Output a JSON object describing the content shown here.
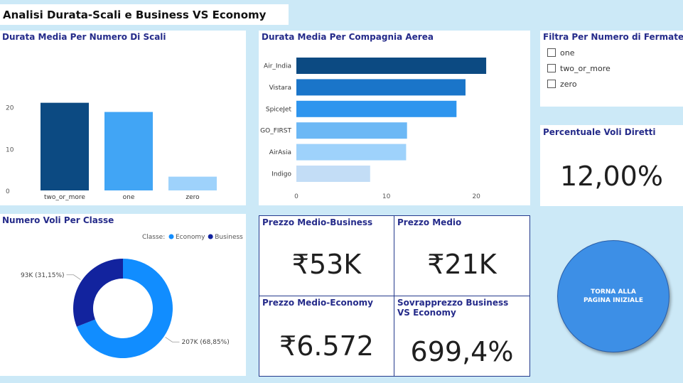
{
  "header": {
    "title": "Analisi Durata-Scali e Business VS Economy"
  },
  "stops_chart": {
    "title": "Durata Media Per Numero Di Scali",
    "chart_data": {
      "type": "bar",
      "categories": [
        "two_or_more",
        "one",
        "zero"
      ],
      "values": [
        21.0,
        18.8,
        3.3
      ],
      "colors": [
        "#0c4a82",
        "#41a5f5",
        "#9ed2fb"
      ],
      "yticks": [
        "0",
        "10",
        "20"
      ],
      "ylim": [
        0,
        22.3
      ]
    }
  },
  "airline_chart": {
    "title": "Durata Media Per Compagnia Aerea",
    "chart_data": {
      "type": "bar",
      "orientation": "horizontal",
      "categories": [
        "Air_India",
        "Vistara",
        "SpiceJet",
        "GO_FIRST",
        "AirAsia",
        "Indigo"
      ],
      "values": [
        21.1,
        18.8,
        17.8,
        12.3,
        12.2,
        8.2
      ],
      "colors": [
        "#0c4a82",
        "#1a75c9",
        "#2e95ee",
        "#6cb8f5",
        "#9ed2fb",
        "#c3ddf6"
      ],
      "xticks": [
        "0",
        "10",
        "20"
      ],
      "xlim": [
        0,
        23.7
      ]
    }
  },
  "filter": {
    "title": "Filtra Per Numero di Fermate",
    "options": [
      "one",
      "two_or_more",
      "zero"
    ]
  },
  "direct": {
    "title": "Percentuale Voli Diretti",
    "value": "12,00%"
  },
  "class_chart": {
    "title": "Numero Voli Per Classe",
    "legend_label": "Classe:",
    "chart_data": {
      "type": "pie",
      "series": [
        {
          "name": "Economy",
          "value": 207000,
          "label": "207K (68,85%)",
          "color": "#118dff"
        },
        {
          "name": "Business",
          "value": 93000,
          "label": "93K (31,15%)",
          "color": "#12239e"
        }
      ]
    }
  },
  "kpis": {
    "business_title": "Prezzo Medio-Business",
    "business_value": "₹53K",
    "avg_title": "Prezzo Medio",
    "avg_value": "₹21K",
    "economy_title": "Prezzo Medio-Economy",
    "economy_value": "₹6.572",
    "surcharge_title": "Sovrapprezzo Business VS Economy",
    "surcharge_value": "699,4%"
  },
  "button": {
    "label": "TORNA ALLA PAGINA INIZIALE"
  }
}
